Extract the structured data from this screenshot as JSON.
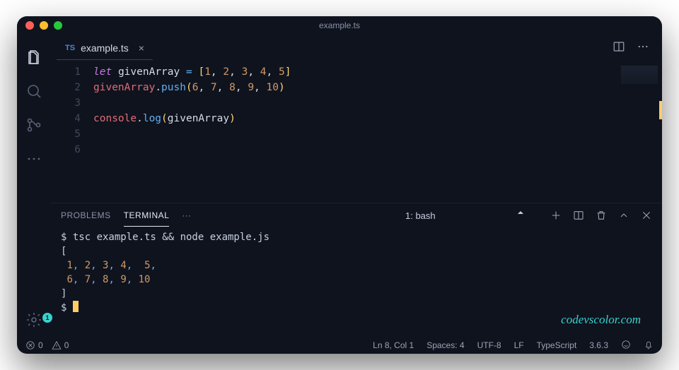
{
  "window": {
    "title": "example.ts"
  },
  "activitybar": {
    "settings_badge": "1"
  },
  "tab": {
    "lang_badge": "TS",
    "filename": "example.ts",
    "close_glyph": "×"
  },
  "editor": {
    "lines": [
      {
        "n": "1",
        "tokens": [
          {
            "cls": "tok-kw",
            "t": "let"
          },
          {
            "cls": "",
            "t": " "
          },
          {
            "cls": "tok-var",
            "t": "givenArray"
          },
          {
            "cls": "",
            "t": " "
          },
          {
            "cls": "tok-op",
            "t": "="
          },
          {
            "cls": "",
            "t": " "
          },
          {
            "cls": "tok-punc",
            "t": "["
          },
          {
            "cls": "tok-num",
            "t": "1"
          },
          {
            "cls": "tok-white",
            "t": ", "
          },
          {
            "cls": "tok-num",
            "t": "2"
          },
          {
            "cls": "tok-white",
            "t": ", "
          },
          {
            "cls": "tok-num",
            "t": "3"
          },
          {
            "cls": "tok-white",
            "t": ", "
          },
          {
            "cls": "tok-num",
            "t": "4"
          },
          {
            "cls": "tok-white",
            "t": ", "
          },
          {
            "cls": "tok-num",
            "t": "5"
          },
          {
            "cls": "tok-punc",
            "t": "]"
          }
        ]
      },
      {
        "n": "2",
        "tokens": [
          {
            "cls": "tok-obj",
            "t": "givenArray"
          },
          {
            "cls": "tok-white",
            "t": "."
          },
          {
            "cls": "tok-fn",
            "t": "push"
          },
          {
            "cls": "tok-punc",
            "t": "("
          },
          {
            "cls": "tok-num",
            "t": "6"
          },
          {
            "cls": "tok-white",
            "t": ", "
          },
          {
            "cls": "tok-num",
            "t": "7"
          },
          {
            "cls": "tok-white",
            "t": ", "
          },
          {
            "cls": "tok-num",
            "t": "8"
          },
          {
            "cls": "tok-white",
            "t": ", "
          },
          {
            "cls": "tok-num",
            "t": "9"
          },
          {
            "cls": "tok-white",
            "t": ", "
          },
          {
            "cls": "tok-num",
            "t": "10"
          },
          {
            "cls": "tok-punc",
            "t": ")"
          }
        ]
      },
      {
        "n": "3",
        "tokens": []
      },
      {
        "n": "4",
        "tokens": [
          {
            "cls": "tok-obj",
            "t": "console"
          },
          {
            "cls": "tok-white",
            "t": "."
          },
          {
            "cls": "tok-fn",
            "t": "log"
          },
          {
            "cls": "tok-punc",
            "t": "("
          },
          {
            "cls": "tok-var",
            "t": "givenArray"
          },
          {
            "cls": "tok-punc",
            "t": ")"
          }
        ]
      },
      {
        "n": "5",
        "tokens": []
      },
      {
        "n": "6",
        "tokens": []
      }
    ]
  },
  "panel": {
    "tabs": {
      "problems": "PROBLEMS",
      "terminal": "TERMINAL",
      "more": "···"
    },
    "shell_select": "1: bash"
  },
  "terminal": {
    "prompt": "$",
    "command": "tsc example.ts && node example.js",
    "output_open": "[",
    "output_row1": [
      " ",
      "1",
      ", ",
      "2",
      ", ",
      "3",
      ", ",
      "4",
      ",  ",
      "5",
      ","
    ],
    "output_row2": [
      " ",
      "6",
      ", ",
      "7",
      ", ",
      "8",
      ", ",
      "9",
      ", ",
      "10"
    ],
    "output_close": "]"
  },
  "statusbar": {
    "errors": "0",
    "warnings": "0",
    "cursor": "Ln 8, Col 1",
    "spaces": "Spaces: 4",
    "encoding": "UTF-8",
    "eol": "LF",
    "language": "TypeScript",
    "version": "3.6.3"
  },
  "watermark": "codevscolor.com"
}
